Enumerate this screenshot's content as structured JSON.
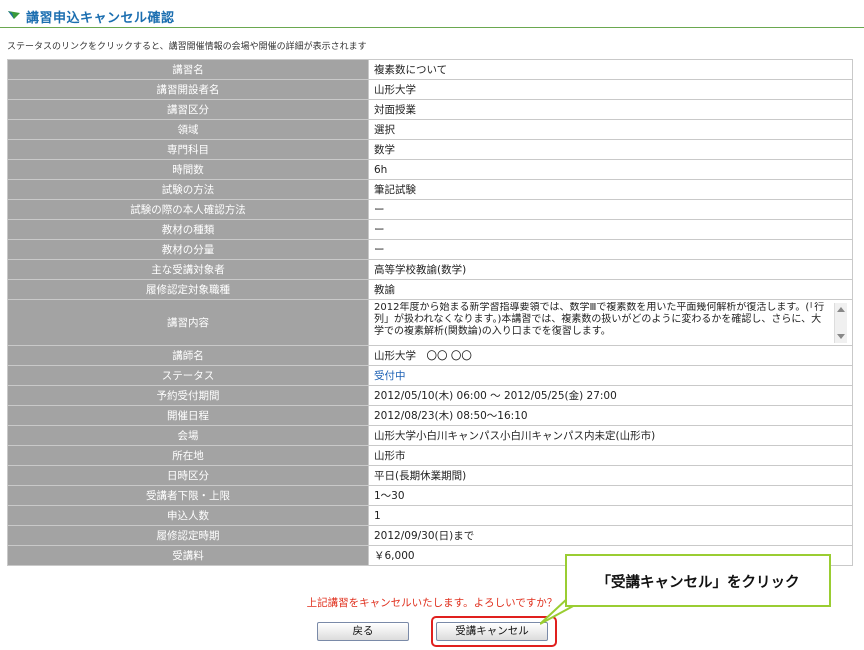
{
  "header": {
    "title": "講習申込キャンセル確認",
    "icon": "green-arrow-icon"
  },
  "note": "ステータスのリンクをクリックすると、講習開催情報の会場や開催の詳細が表示されます",
  "table": {
    "rows": [
      {
        "label": "講習名",
        "value": "複素数について"
      },
      {
        "label": "講習開設者名",
        "value": "山形大学"
      },
      {
        "label": "講習区分",
        "value": "対面授業"
      },
      {
        "label": "領域",
        "value": "選択"
      },
      {
        "label": "専門科目",
        "value": "数学"
      },
      {
        "label": "時間数",
        "value": "6h"
      },
      {
        "label": "試験の方法",
        "value": "筆記試験"
      },
      {
        "label": "試験の際の本人確認方法",
        "value": "ー"
      },
      {
        "label": "教材の種類",
        "value": "ー"
      },
      {
        "label": "教材の分量",
        "value": "ー"
      },
      {
        "label": "主な受講対象者",
        "value": "高等学校教諭(数学)"
      },
      {
        "label": "履修認定対象職種",
        "value": "教諭"
      },
      {
        "label": "講習内容",
        "value": "2012年度から始まる新学習指導要領では、数学Ⅲで複素数を用いた平面幾何解析が復活します。(「行列」が扱われなくなります。)本講習では、複素数の扱いがどのように変わるかを確認し、さらに、大学での複素解析(関数論)の入り口までを復習します。"
      },
      {
        "label": "講師名",
        "value": "山形大学　〇〇 〇〇"
      },
      {
        "label": "ステータス",
        "value": "受付中"
      },
      {
        "label": "予約受付期間",
        "value": "2012/05/10(木) 06:00 ～ 2012/05/25(金) 27:00"
      },
      {
        "label": "開催日程",
        "value": "2012/08/23(木) 08:50～16:10"
      },
      {
        "label": "会場",
        "value": "山形大学小白川キャンパス小白川キャンパス内未定(山形市)"
      },
      {
        "label": "所在地",
        "value": "山形市"
      },
      {
        "label": "日時区分",
        "value": "平日(長期休業期間)"
      },
      {
        "label": "受講者下限・上限",
        "value": "1～30"
      },
      {
        "label": "申込人数",
        "value": "1"
      },
      {
        "label": "履修認定時期",
        "value": "2012/09/30(日)まで"
      },
      {
        "label": "受講料",
        "value": "￥6,000"
      }
    ]
  },
  "confirm_message": "上記講習をキャンセルいたします。よろしいですか？",
  "buttons": {
    "back": "戻る",
    "cancel": "受講キャンセル"
  },
  "callout": "「受講キャンセル」をクリック",
  "colors": {
    "title": "#1b6eb0",
    "label_bg": "#a3a3a3",
    "status_link": "#1a5fb4",
    "confirm_text": "#e0301e",
    "highlight": "#e0201e",
    "callout_border": "#9acd32"
  }
}
